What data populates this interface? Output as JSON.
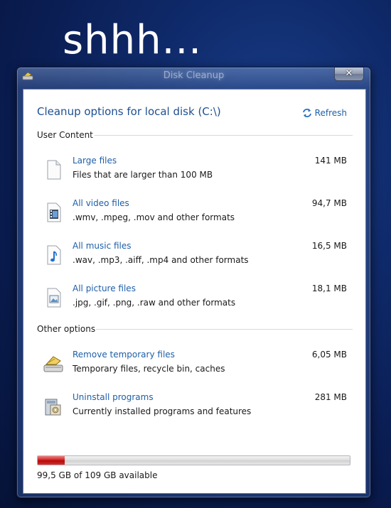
{
  "desktop": {
    "overlay_text": "shhh..."
  },
  "window": {
    "title": "Disk Cleanup",
    "close_glyph": "✕"
  },
  "header": {
    "title": "Cleanup options for local disk (C:\\)",
    "refresh_label": "Refresh"
  },
  "sections": {
    "user_content": {
      "label": "User Content",
      "items": [
        {
          "title": "Large files",
          "desc": "Files that are larger than 100 MB",
          "size": "141 MB",
          "icon": "file-icon"
        },
        {
          "title": "All video files",
          "desc": ".wmv, .mpeg, .mov and other formats",
          "size": "94,7 MB",
          "icon": "video-file-icon"
        },
        {
          "title": "All music files",
          "desc": ".wav, .mp3, .aiff, .mp4 and other formats",
          "size": "16,5 MB",
          "icon": "music-file-icon"
        },
        {
          "title": "All picture files",
          "desc": ".jpg, .gif, .png, .raw and other formats",
          "size": "18,1 MB",
          "icon": "picture-file-icon"
        }
      ]
    },
    "other_options": {
      "label": "Other options",
      "items": [
        {
          "title": "Remove temporary files",
          "desc": "Temporary files, recycle bin, caches",
          "size": "6,05 MB",
          "icon": "disk-cleanup-icon"
        },
        {
          "title": "Uninstall programs",
          "desc": "Currently installed programs and features",
          "size": "281 MB",
          "icon": "programs-icon"
        }
      ]
    }
  },
  "disk": {
    "used_fraction": 0.087,
    "status": "99,5 GB of 109 GB available"
  },
  "colors": {
    "link": "#1e5fa8",
    "heading": "#1e4f91",
    "progress_fill": "#c81818"
  }
}
